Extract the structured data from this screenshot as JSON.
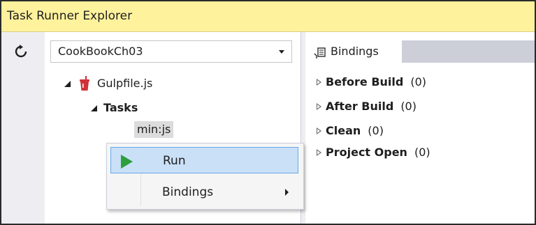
{
  "window": {
    "title": "Task Runner Explorer"
  },
  "toolbar": {
    "refresh_icon": "refresh-icon",
    "project_selected": "CookBookCh03"
  },
  "tree": {
    "file": {
      "label": "Gulpfile.js",
      "icon": "gulp-cup-icon"
    },
    "tasks_label": "Tasks",
    "task_items": [
      "min:js"
    ]
  },
  "bindings_panel": {
    "tab_label": "Bindings",
    "tab_icon": "bindings-icon",
    "items": [
      {
        "label": "Before Build",
        "count": "(0)"
      },
      {
        "label": "After Build",
        "count": "(0)"
      },
      {
        "label": "Clean",
        "count": "(0)"
      },
      {
        "label": "Project Open",
        "count": "(0)"
      }
    ]
  },
  "context_menu": {
    "items": [
      {
        "label": "Run",
        "icon": "play-icon",
        "highlighted": true
      },
      {
        "label": "Bindings",
        "has_submenu": true
      }
    ]
  },
  "colors": {
    "titlebar_bg": "#fff29d",
    "run_icon": "#2f9e3e",
    "menu_highlight": "#c9e0f7",
    "gulp_red": "#cf3338"
  }
}
